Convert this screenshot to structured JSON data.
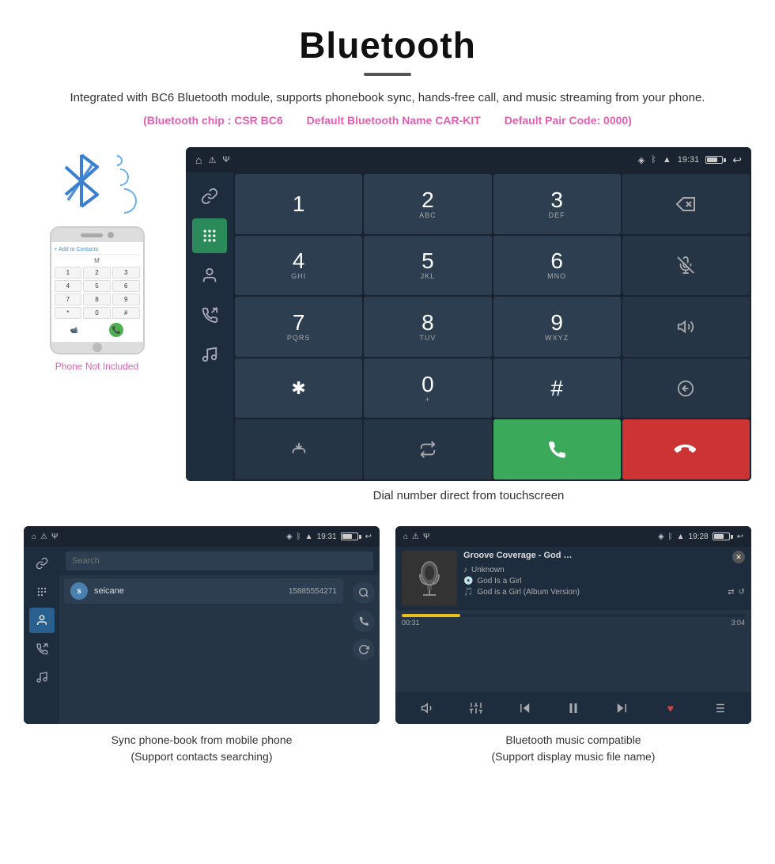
{
  "header": {
    "title": "Bluetooth",
    "description": "Integrated with BC6 Bluetooth module, supports phonebook sync, hands-free call, and music streaming from your phone.",
    "spec1": "(Bluetooth chip : CSR BC6",
    "spec2": "Default Bluetooth Name CAR-KIT",
    "spec3": "Default Pair Code: 0000)",
    "underline_char": "—"
  },
  "phone_panel": {
    "not_included": "Phone Not Included"
  },
  "dialer": {
    "caption": "Dial number direct from touchscreen",
    "time": "19:31",
    "keys": [
      {
        "main": "1",
        "sub": ""
      },
      {
        "main": "2",
        "sub": "ABC"
      },
      {
        "main": "3",
        "sub": "DEF"
      },
      {
        "main": "⌫",
        "sub": "",
        "type": "backspace"
      },
      {
        "main": "4",
        "sub": "GHI"
      },
      {
        "main": "5",
        "sub": "JKL"
      },
      {
        "main": "6",
        "sub": "MNO"
      },
      {
        "main": "🎤",
        "sub": "",
        "type": "mute"
      },
      {
        "main": "7",
        "sub": "PQRS"
      },
      {
        "main": "8",
        "sub": "TUV"
      },
      {
        "main": "9",
        "sub": "WXYZ"
      },
      {
        "main": "🔊",
        "sub": "",
        "type": "vol"
      },
      {
        "main": "✱",
        "sub": ""
      },
      {
        "main": "0",
        "sub": "+"
      },
      {
        "main": "#",
        "sub": ""
      },
      {
        "main": "⇅",
        "sub": "",
        "type": "swap"
      },
      {
        "main": "⋮",
        "sub": "",
        "type": "merge"
      },
      {
        "main": "⇅",
        "sub": "",
        "type": "dtmf"
      },
      {
        "main": "📞",
        "sub": "",
        "type": "call-green"
      },
      {
        "main": "📵",
        "sub": "",
        "type": "call-red"
      }
    ]
  },
  "phonebook": {
    "search_placeholder": "Search",
    "contact_name": "seicane",
    "contact_phone": "15885554271",
    "contact_initial": "s",
    "time": "19:31",
    "caption_line1": "Sync phone-book from mobile phone",
    "caption_line2": "(Support contacts searching)"
  },
  "music": {
    "time": "19:28",
    "title": "Groove Coverage - God Is A Gir...",
    "artist": "Unknown",
    "album": "God Is a Girl",
    "track": "God is a Girl (Album Version)",
    "progress_current": "00:31",
    "progress_total": "3:04",
    "progress_pct": 17,
    "caption_line1": "Bluetooth music compatible",
    "caption_line2": "(Support display music file name)"
  },
  "icons": {
    "bluetooth": "ᛒ",
    "phone": "📞",
    "contacts": "👤",
    "call_log": "📋",
    "music": "🎵",
    "link": "🔗",
    "dialpad": "⌨",
    "search": "🔍",
    "call_green": "📞",
    "call_red": "📵",
    "speaker": "🔊",
    "mute": "🎤",
    "prev": "⏮",
    "next": "⏭",
    "play": "⏸",
    "shuffle": "🔀",
    "repeat": "🔁",
    "heart": "♥",
    "playlist": "☰",
    "vol": "🔊"
  }
}
